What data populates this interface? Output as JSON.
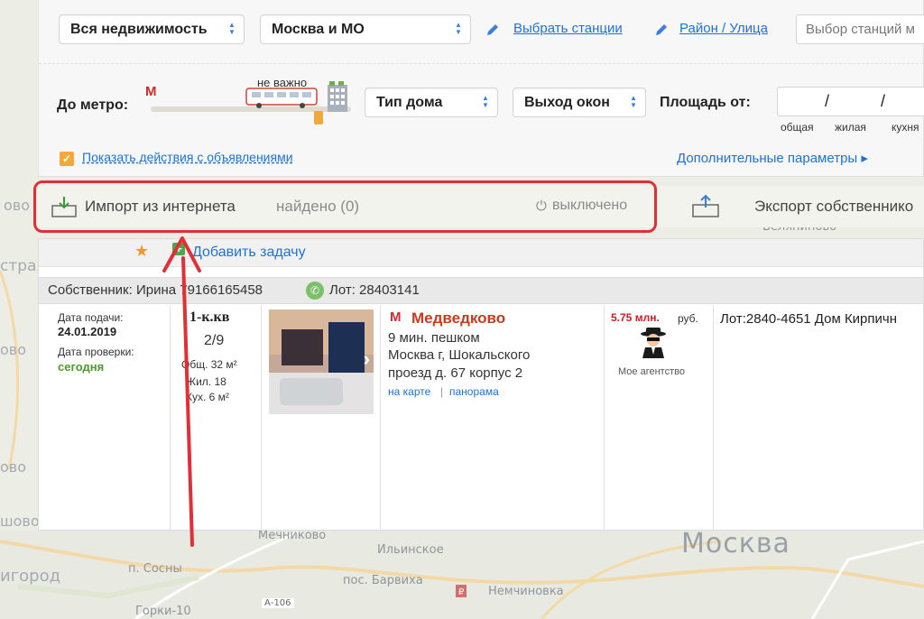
{
  "filters": {
    "property_type": "Вся недвижимость",
    "region": "Москва и МО",
    "stations_link": "Выбрать станции",
    "district_link": "Район / Улица",
    "station_input_placeholder": "Выбор станций м",
    "metro_label": "До метро:",
    "metro_marker": "М",
    "metro_distance": "не важно",
    "house_type": "Тип дома",
    "window_view": "Выход окон",
    "area_label": "Площадь от:",
    "area_slash": "/",
    "area_total": "общая",
    "area_living": "жилая",
    "area_kitchen": "кухня",
    "show_actions": "Показать действия с объявлениями",
    "more_params": "Дополнительные параметры ▸"
  },
  "import_bar": {
    "import_label": "Импорт из интернета",
    "found": "найдено (0)",
    "status": "выключено",
    "export_label": "Экспорт собственнико"
  },
  "listing": {
    "add_task": "Добавить задачу",
    "owner": "Собственник: Ирина 79166165458",
    "lot": "Лот: 28403141",
    "submit_label": "Дата подачи:",
    "submit_date": "24.01.2019",
    "check_label": "Дата проверки:",
    "check_value": "сегодня",
    "rooms": "1-к.кв",
    "floor": "2/9",
    "area_total": "Общ. 32 м²",
    "area_living": "Жил. 18",
    "area_kitchen": "Кух. 6 м²",
    "metro_marker": "М",
    "metro": "Медведково",
    "walk": "9 мин. пешком",
    "address_1": "Москва г, Шокальского",
    "address_2": "проезд д. 67 корпус 2",
    "map_link": "на карте",
    "sep": "|",
    "panorama_link": "панорама",
    "price": "5.75 млн.",
    "currency": "руб.",
    "agency": "Мое агентство",
    "description": "Лот:2840-4651 Дом Кирпичн"
  },
  "map": {
    "moscow": "Москва",
    "mechnikovo": "Мечниково",
    "ilinskoe": "Ильинское",
    "p_sosny": "п. Сосны",
    "barvikha": "пос. Барвиха",
    "nemchinovka": "Немчиновка",
    "gorki": "Горки-10",
    "road": "А-106",
    "beleninovo": "Беляниново",
    "gorod_left": "игород",
    "left_1": "ово",
    "left_2": "страх",
    "left_3": "ово",
    "left_4": "ово",
    "left_5": "шово"
  },
  "colors": {
    "accent_blue": "#1d72d8",
    "highlight_red": "#e03036",
    "metro_red": "#d6282e",
    "check_green": "#4c9a2a",
    "price_red": "#cc1f24",
    "checkbox_orange": "#f2a93b"
  }
}
